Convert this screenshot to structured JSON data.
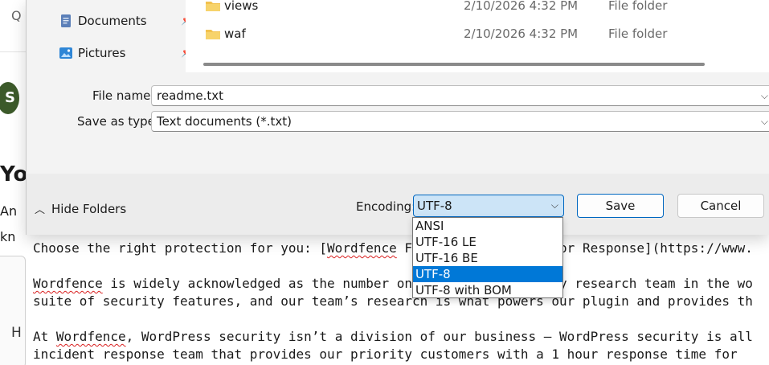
{
  "background": {
    "heading_fragment": "Yo",
    "line_an": "An",
    "line_kn": "kn",
    "avatar_letter": "S",
    "card_letter": "H",
    "editor_lines": [
      {
        "pre": "Choose the right protection for you: [",
        "squig": "Wordfence",
        "post": " Free, Premium, Care or Response](https://www."
      },
      {
        "pre": "",
        "squig": "Wordfence",
        "post": " is widely acknowledged as the number one WordPress security research team in the wo"
      },
      {
        "pre": "suite of security features, and our team’s research is what powers our plugin and provides th",
        "squig": "",
        "post": ""
      },
      {
        "pre": "At ",
        "squig": "Wordfence",
        "post": ", WordPress security isn’t a division of our business – WordPress security is all"
      },
      {
        "pre": "incident response team that provides our priority customers with a 1 hour response time for",
        "squig": "",
        "post": ""
      }
    ]
  },
  "dialog": {
    "nav": [
      {
        "label": "Documents",
        "icon": "documents-icon"
      },
      {
        "label": "Pictures",
        "icon": "pictures-icon"
      }
    ],
    "files": [
      {
        "name": "views",
        "date": "2/10/2026 4:32 PM",
        "type": "File folder"
      },
      {
        "name": "waf",
        "date": "2/10/2026 4:32 PM",
        "type": "File folder"
      }
    ],
    "file_name_label": "File name:",
    "file_name_value": "readme.txt",
    "save_as_type_label": "Save as type:",
    "save_as_type_value": "Text documents (*.txt)",
    "hide_folders_label": "Hide Folders",
    "encoding_label": "Encoding:",
    "encoding_value": "UTF-8",
    "encoding_options": [
      "ANSI",
      "UTF-16 LE",
      "UTF-16 BE",
      "UTF-8",
      "UTF-8 with BOM"
    ],
    "encoding_selected_index": 3,
    "save_label": "Save",
    "cancel_label": "Cancel"
  },
  "colors": {
    "accent": "#0078d7",
    "select_bg": "#cce4f7",
    "folder": "#f2c14e"
  }
}
